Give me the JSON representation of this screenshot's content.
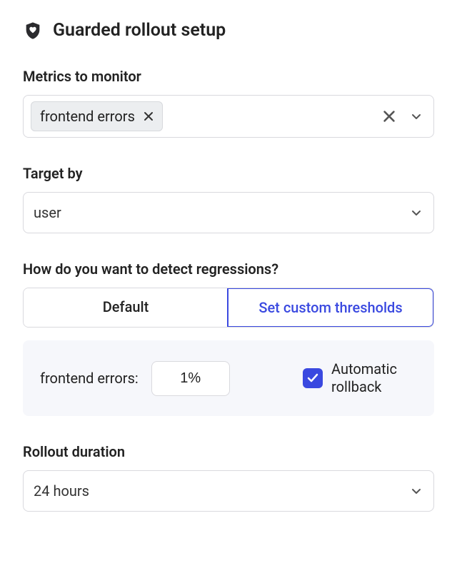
{
  "header": {
    "title": "Guarded rollout setup"
  },
  "metrics": {
    "label": "Metrics to monitor",
    "chips": [
      {
        "label": "frontend errors"
      }
    ]
  },
  "targetBy": {
    "label": "Target by",
    "value": "user"
  },
  "detect": {
    "label": "How do you want to detect regressions?",
    "options": {
      "default": "Default",
      "custom": "Set custom thresholds"
    },
    "selected": "custom",
    "threshold": {
      "metricLabel": "frontend errors:",
      "value": "1%",
      "autoRollbackLabel": "Automatic rollback",
      "autoRollbackChecked": true
    }
  },
  "duration": {
    "label": "Rollout duration",
    "value": "24 hours"
  }
}
